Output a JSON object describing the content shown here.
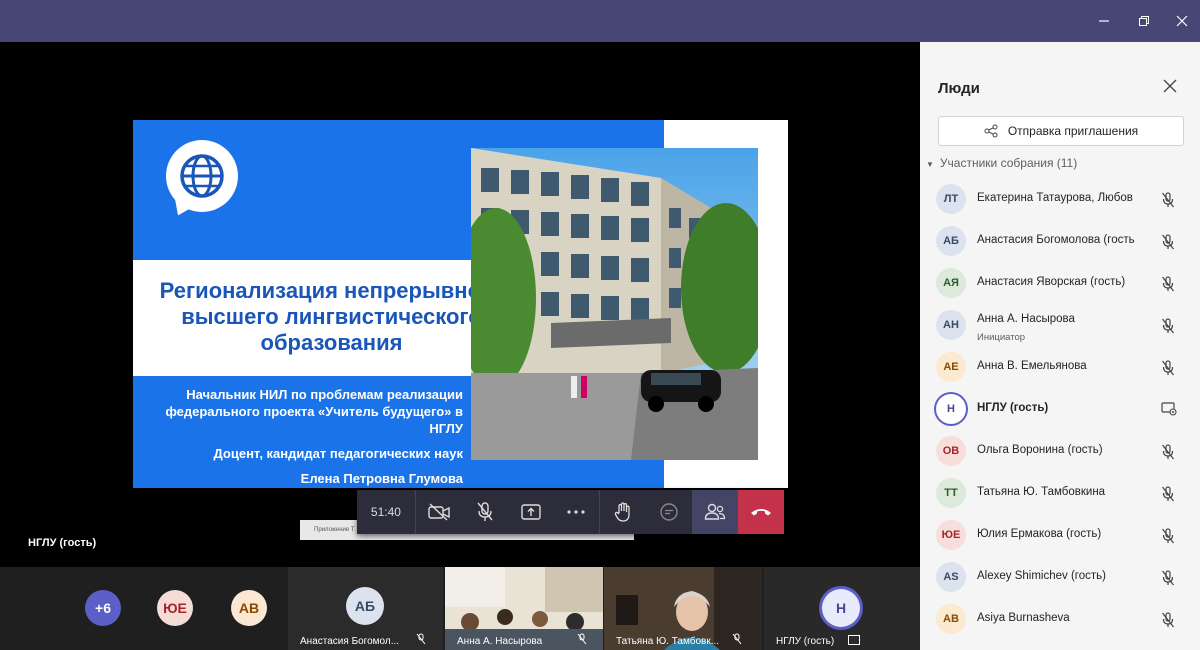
{
  "window": {
    "minimize_icon": "minimize-icon",
    "maximize_icon": "maximize-icon",
    "close_icon": "close-icon"
  },
  "stage": {
    "slide": {
      "title": "Регионализация непрерывного высшего лингвистического образования",
      "subtitle_lines": [
        "Начальник НИЛ по проблемам реализации",
        "федерального проекта «Учитель будущего» в",
        "НГЛУ",
        "Доцент, кандидат педагогических наук",
        "Елена Петровна Глумова"
      ]
    },
    "presenter_label": "НГЛУ (гость)",
    "notification": "Приложение Т",
    "toolbar": {
      "time": "51:40"
    }
  },
  "gallery": {
    "avatars": [
      {
        "initials": "+6",
        "bg": "#5b5fc7",
        "fg": "#ffffff"
      },
      {
        "initials": "ЮЕ",
        "bg": "#f6dcd7",
        "fg": "#a4262c"
      },
      {
        "initials": "АВ",
        "bg": "#fbe7d3",
        "fg": "#8a4a00"
      }
    ],
    "tiles": [
      {
        "initials": "АБ",
        "name": "Анастасия Богомол..."
      },
      {
        "name": "Анна А. Насырова"
      },
      {
        "name": "Татьяна Ю. Тамбовк..."
      },
      {
        "initials": "Н",
        "name": "НГЛУ (гость)"
      }
    ]
  },
  "panel": {
    "title": "Люди",
    "invite_label": "Отправка приглашения",
    "section_label": "Участники собрания (11)",
    "participants": [
      {
        "initials": "ЛТ",
        "name": "Екатерина Татаурова, Любов",
        "role": "",
        "bg": "#dde3ee",
        "fg": "#3b4a66"
      },
      {
        "initials": "АБ",
        "name": "Анастасия Богомолова (гость",
        "role": "",
        "bg": "#dde3ee",
        "fg": "#3b4a66"
      },
      {
        "initials": "АЯ",
        "name": "Анастасия Яворская (гость)",
        "role": "",
        "bg": "#dbeadb",
        "fg": "#2c5e2e"
      },
      {
        "initials": "АН",
        "name": "Анна А. Насырова",
        "role": "Инициатор",
        "bg": "#dde3ee",
        "fg": "#3b4a66"
      },
      {
        "initials": "АЕ",
        "name": "Анна В. Емельянова",
        "role": "",
        "bg": "#fbe9d0",
        "fg": "#8a4a00"
      },
      {
        "initials": "Н",
        "name": "НГЛУ (гость)",
        "role": "",
        "bg": "#e8ebfa",
        "fg": "#444791"
      },
      {
        "initials": "ОВ",
        "name": "Ольга Воронина (гость)",
        "role": "",
        "bg": "#f8dedb",
        "fg": "#a4262c"
      },
      {
        "initials": "ТТ",
        "name": "Татьяна Ю. Тамбовкина",
        "role": "",
        "bg": "#dbeadb",
        "fg": "#2c5e2e"
      },
      {
        "initials": "ЮЕ",
        "name": "Юлия Ермакова (гость)",
        "role": "",
        "bg": "#f8dedb",
        "fg": "#a4262c"
      },
      {
        "initials": "AS",
        "name": "Alexey Shimichev (гость)",
        "role": "",
        "bg": "#dde3ee",
        "fg": "#3b4a66"
      },
      {
        "initials": "AB",
        "name": "Asiya Burnasheva",
        "role": "",
        "bg": "#fbe9d0",
        "fg": "#8a4a00"
      }
    ]
  }
}
